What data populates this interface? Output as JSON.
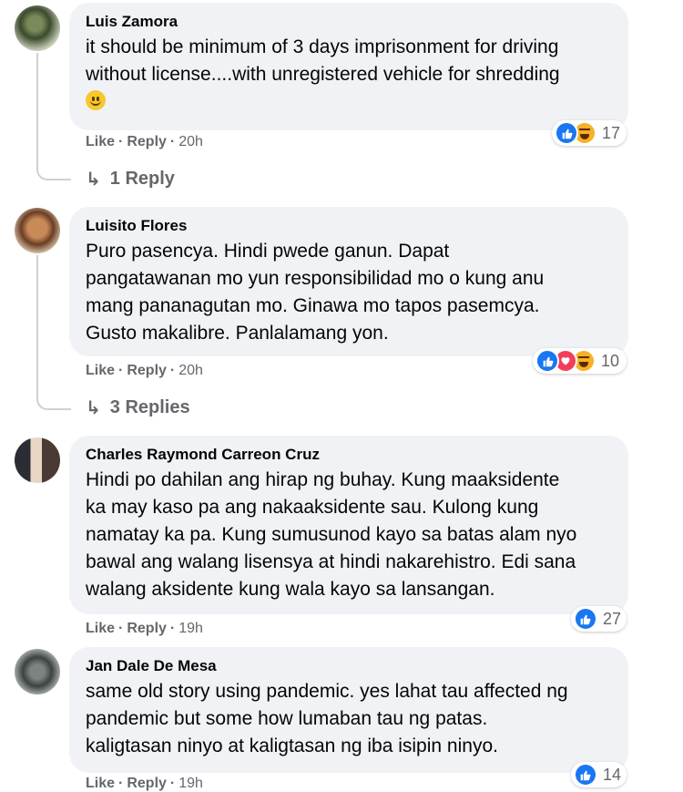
{
  "comments": [
    {
      "author": "Luis Zamora",
      "text": "it should be minimum of 3 days imprisonment for driving\nwithout license....with unregistered vehicle for shredding",
      "emoji": "slightly-smiling-face-emoji",
      "reaction_count": "17",
      "reactions": [
        "like-reaction-icon",
        "haha-reaction-icon"
      ],
      "like_label": "Like",
      "reply_label": "Reply",
      "time": "20h",
      "replies_label": "1 Reply"
    },
    {
      "author": "Luisito Flores",
      "text": "Puro pasencya. Hindi pwede ganun. Dapat\npangatawanan mo yun responsibilidad mo o kung anu\nmang pananagutan mo. Ginawa mo tapos pasemcya.\nGusto makalibre. Panlalamang yon.",
      "reaction_count": "10",
      "reactions": [
        "like-reaction-icon",
        "love-reaction-icon",
        "haha-reaction-icon"
      ],
      "like_label": "Like",
      "reply_label": "Reply",
      "time": "20h",
      "replies_label": "3 Replies"
    },
    {
      "author": "Charles Raymond Carreon Cruz",
      "text": "Hindi po dahilan ang hirap ng buhay. Kung maaksidente\nka may kaso pa ang nakaaksidente sau. Kulong kung\nnamatay ka pa. Kung sumusunod kayo sa batas alam nyo\nbawal ang walang lisensya at hindi nakarehistro. Edi sana\nwalang aksidente kung wala kayo sa lansangan.",
      "reaction_count": "27",
      "reactions": [
        "like-reaction-icon"
      ],
      "like_label": "Like",
      "reply_label": "Reply",
      "time": "19h"
    },
    {
      "author": "Jan Dale De Mesa",
      "text": "same old story using pandemic. yes lahat tau affected ng\npandemic but some how lumaban tau ng patas.\nkaligtasan ninyo at kaligtasan ng iba isipin ninyo.",
      "reaction_count": "14",
      "reactions": [
        "like-reaction-icon"
      ],
      "like_label": "Like",
      "reply_label": "Reply",
      "time": "19h"
    }
  ],
  "icons": {
    "reply_arrow": "↳",
    "like_glyph": "👍"
  },
  "colors": {
    "bubble": "#f0f2f5",
    "secondary_text": "#65676b",
    "like_blue": "#1877f2",
    "love_red": "#f33e58",
    "haha_yellow": "#f7b125"
  }
}
